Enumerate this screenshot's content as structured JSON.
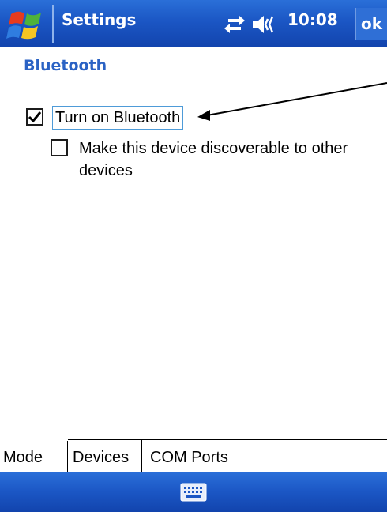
{
  "titlebar": {
    "title": "Settings",
    "time": "10:08",
    "ok_label": "ok",
    "start_icon": "windows-flag-icon",
    "connectivity_icon": "connectivity-arrows-icon",
    "volume_icon": "speaker-icon"
  },
  "page": {
    "heading": "Bluetooth"
  },
  "options": {
    "bluetooth_on": {
      "label": "Turn on Bluetooth",
      "checked": true
    },
    "discoverable": {
      "label": "Make this device discoverable to other devices",
      "checked": false
    }
  },
  "tabs": [
    {
      "label": "Mode",
      "active": true
    },
    {
      "label": "Devices",
      "active": false
    },
    {
      "label": "COM Ports",
      "active": false
    }
  ],
  "menubar": {
    "keyboard_icon": "keyboard-icon"
  },
  "colors": {
    "titlebar_blue": "#1b56c4",
    "heading_blue": "#2a62c4",
    "focus_border": "#4e9bd8"
  }
}
